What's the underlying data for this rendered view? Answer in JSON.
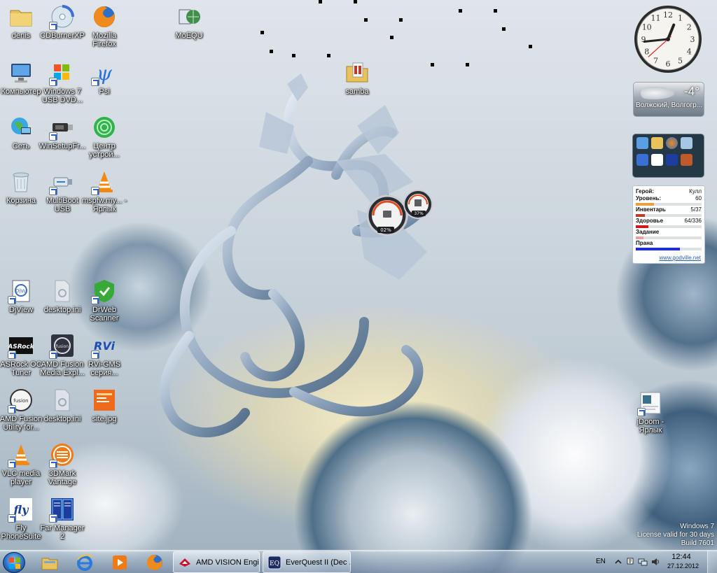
{
  "desktop": {
    "icons": [
      {
        "label": "denis",
        "icon": "user-folder-icon"
      },
      {
        "label": "CDBurnerXP",
        "icon": "cdburner-icon"
      },
      {
        "label": "Mozilla Firefox",
        "icon": "firefox-icon"
      },
      {
        "label": "MoEQU",
        "icon": "moequ-icon"
      },
      {
        "label": "Компьютер",
        "icon": "computer-icon"
      },
      {
        "label": "Windows 7 USB DVD...",
        "icon": "windows-usb-icon"
      },
      {
        "label": "Psi",
        "icon": "psi-icon"
      },
      {
        "label": "samba",
        "icon": "samba-folder-icon"
      },
      {
        "label": "Сеть",
        "icon": "network-icon"
      },
      {
        "label": "WinSetupFr...",
        "icon": "winsetup-icon"
      },
      {
        "label": "Центр устрой...",
        "icon": "device-center-icon"
      },
      {
        "label": "Корзина",
        "icon": "recycle-bin-icon"
      },
      {
        "label": "MultiBoot USB",
        "icon": "multiboot-usb-icon"
      },
      {
        "label": "mspfw.my... - Ярлык",
        "icon": "vlc-shortcut-icon"
      },
      {
        "label": "DjView",
        "icon": "djview-icon"
      },
      {
        "label": "desktop.ini",
        "icon": "ini-file-icon"
      },
      {
        "label": "DrWeb Scanner",
        "icon": "drweb-icon"
      },
      {
        "label": "ASRock OC Tuner",
        "icon": "asrock-icon"
      },
      {
        "label": "AMD Fusion Media Expl...",
        "icon": "amd-fusion-media-icon"
      },
      {
        "label": "RVi-GMS серия...",
        "icon": "rvi-icon"
      },
      {
        "label": "AMD Fusion Utility for...",
        "icon": "amd-fusion-utility-icon"
      },
      {
        "label": "desktop.ini",
        "icon": "ini-file-icon"
      },
      {
        "label": "site.jpg",
        "icon": "image-file-icon"
      },
      {
        "label": "VLC media player",
        "icon": "vlc-icon"
      },
      {
        "label": "3DMark Vantage",
        "icon": "3dmark-icon"
      },
      {
        "label": "Fly PhoneSuite",
        "icon": "fly-phonesuite-icon"
      },
      {
        "label": "Far Manager 2",
        "icon": "far-manager-icon"
      },
      {
        "label": "jDoom - Ярлык",
        "icon": "jdoom-icon"
      }
    ]
  },
  "gadgets": {
    "clock": {
      "hour": 12,
      "minute": 44,
      "second": 38
    },
    "weather": {
      "temp": "-4°",
      "city": "Волжский, Волгогр..."
    },
    "meter": {
      "cpu": "02%",
      "ram": "37%"
    },
    "godville": {
      "hero_label": "Герой:",
      "hero_name": "Кулл",
      "level_label": "Уровень:",
      "level_value": "60",
      "level_pct": 0.28,
      "inventory_label": "Инвентарь",
      "inventory_value": "5/37",
      "inventory_pct": 0.14,
      "health_label": "Здоровье",
      "health_value": "64/336",
      "health_pct": 0.19,
      "quest_label": "Задание",
      "quest_pct": 0.12,
      "prana_label": "Прана",
      "prana_pct": 0.67,
      "link": "www.godville.net",
      "colors": {
        "level": "#e8a33c",
        "inventory": "#c0392b",
        "health": "#d21a1a",
        "quest": "#e7a0a0",
        "prana": "#1f2ed0"
      }
    }
  },
  "watermark": {
    "line1": "Windows 7",
    "line2": "License valid for 30 days",
    "line3": "Build 7601"
  },
  "taskbar": {
    "pinned": [
      "explorer-icon",
      "ie-icon",
      "media-player-icon",
      "firefox-icon"
    ],
    "tasks": [
      {
        "label": "AMD VISION Engi...",
        "icon": "amd-vision-icon"
      },
      {
        "label": "EverQuest II (Dec ...",
        "icon": "everquest-icon"
      }
    ],
    "language": "EN",
    "time": "12:44",
    "date": "27.12.2012"
  }
}
